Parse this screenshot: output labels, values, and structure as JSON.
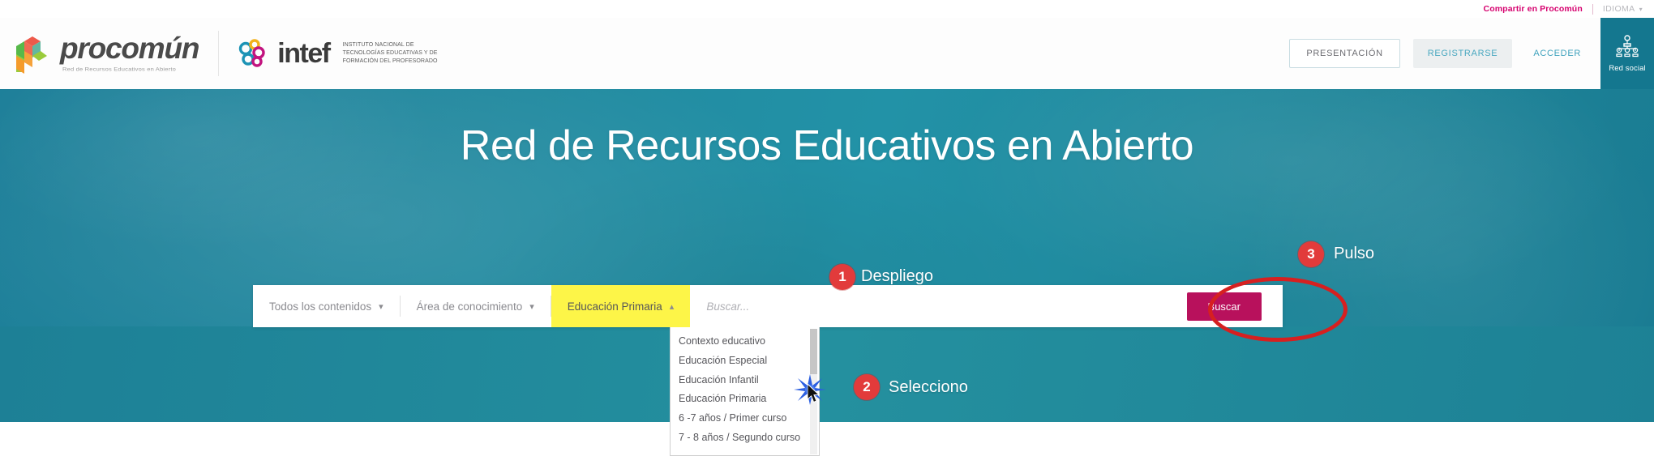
{
  "utility_bar": {
    "share_label": "Compartir en Procomún",
    "language_label": "IDIOMA",
    "language_caret": "⌄"
  },
  "header": {
    "logo_procomun": {
      "name": "procomún",
      "tagline": "Red de Recursos Educativos en Abierto",
      "icon": "cube-logo-icon"
    },
    "logo_intef": {
      "name": "intef",
      "subtitle": "INSTITUTO NACIONAL DE\nTECNOLOGÍAS EDUCATIVAS Y DE\nFORMACIÓN DEL PROFESORADO",
      "icon": "intef-knot-icon"
    },
    "buttons": {
      "presentacion": "PRESENTACIÓN",
      "registrarse": "REGISTRARSE",
      "acceder": "ACCEDER"
    },
    "red_social": {
      "label": "Red social",
      "icon": "network-people-icon"
    }
  },
  "hero": {
    "title": "Red de Recursos Educativos en Abierto"
  },
  "search": {
    "content_filter": "Todos los contenidos",
    "content_filter_caret": "⌄",
    "area_filter": "Área de conocimiento",
    "area_filter_caret": "⌄",
    "level_filter": "Educación Primaria",
    "level_filter_caret": "⌃",
    "input_value": "",
    "placeholder": "Buscar...",
    "submit_label": "Buscar"
  },
  "dropdown": {
    "items": [
      "Contexto educativo",
      "Educación Especial",
      "Educación Infantil",
      "Educación Primaria",
      "6 -7 años / Primer curso",
      "7 - 8 años / Segundo curso"
    ]
  },
  "annotations": [
    {
      "number": "1",
      "label": "Despliego"
    },
    {
      "number": "2",
      "label": "Selecciono"
    },
    {
      "number": "3",
      "label": "Pulso"
    }
  ],
  "colors": {
    "hero_teal": "#22899f",
    "accent_magenta": "#b8115c",
    "highlight_yellow": "#fdf548",
    "annotation_red": "#e23b3b",
    "red_social_bg": "#14778f",
    "share_pink": "#d6006e",
    "link_blue": "#3fa2bd"
  }
}
